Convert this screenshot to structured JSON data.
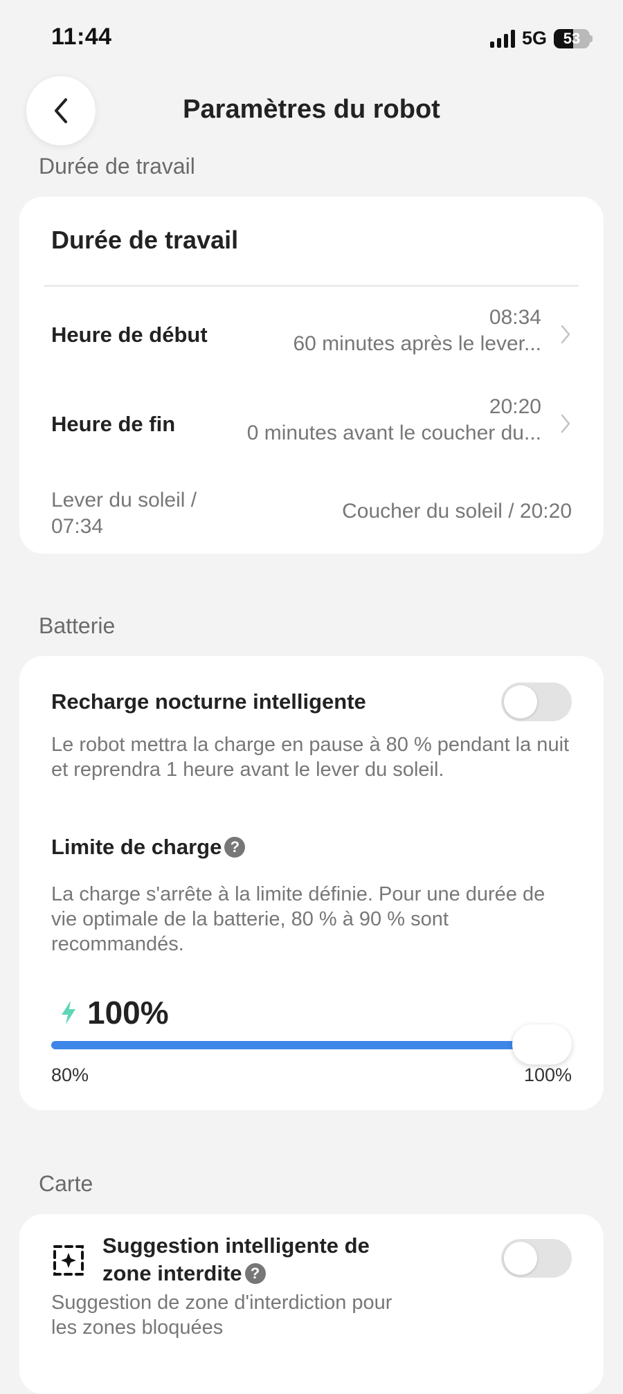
{
  "status_bar": {
    "time": "11:44",
    "network": "5G",
    "battery_level": "53",
    "battery_fraction": 0.53
  },
  "header": {
    "title": "Paramètres du robot"
  },
  "work_section": {
    "label": "Durée de travail",
    "card_title": "Durée de travail",
    "start": {
      "label": "Heure de début",
      "time": "08:34",
      "detail": "60 minutes après le lever..."
    },
    "end": {
      "label": "Heure de fin",
      "time": "20:20",
      "detail": "0 minutes avant le coucher du..."
    },
    "sunrise": "Lever du soleil / 07:34",
    "sunset": "Coucher du soleil / 20:20"
  },
  "battery_section": {
    "label": "Batterie",
    "night_charge": {
      "label": "Recharge nocturne intelligente",
      "enabled": false,
      "description": "Le robot mettra la charge en pause à 80 % pendant la nuit et reprendra 1 heure avant le lever du soleil."
    },
    "charge_limit": {
      "label": "Limite de charge",
      "description": "La charge s'arrête à la limite définie. Pour une durée de vie optimale de la batterie, 80 % à 90 % sont recommandés.",
      "value_text": "100%",
      "value": 100,
      "min": 80,
      "max": 100,
      "min_label": "80%",
      "max_label": "100%"
    },
    "accent_color": "#3e86e8",
    "bolt_color": "#5fd6b8"
  },
  "map_section": {
    "label": "Carte",
    "no_go": {
      "title": "Suggestion intelligente de zone interdite",
      "enabled": false,
      "description": "Suggestion de zone d'interdiction pour les zones bloquées"
    }
  },
  "icons": {
    "back": "chevron-left-icon",
    "chevron": "chevron-right-icon",
    "help": "question-circle-icon",
    "bolt": "lightning-bolt-icon",
    "zone": "sparkle-zone-icon"
  }
}
